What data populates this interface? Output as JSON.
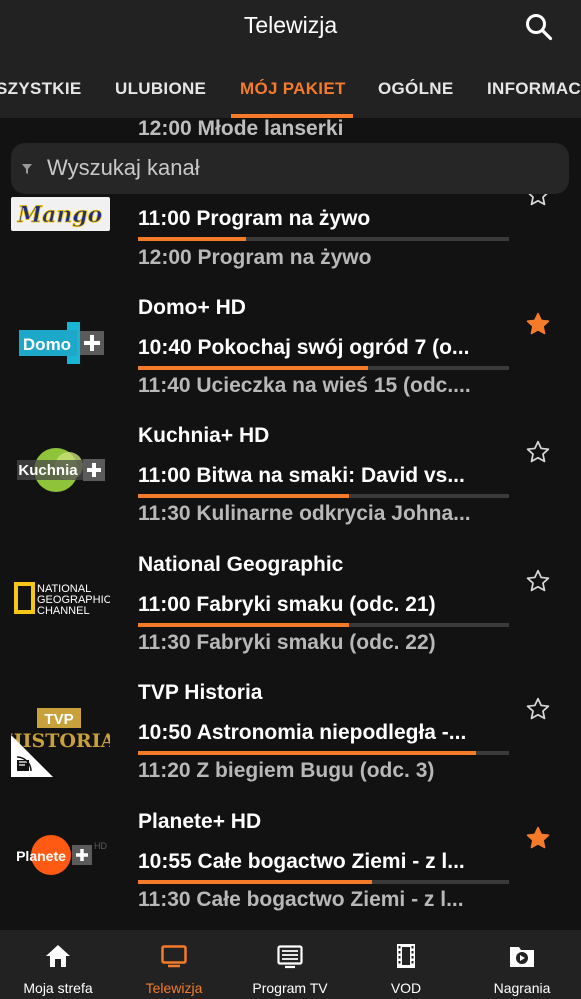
{
  "header": {
    "title": "Telewizja"
  },
  "tabs": [
    {
      "label": "SZYSTKIE",
      "active": false
    },
    {
      "label": "ULUBIONE",
      "active": false
    },
    {
      "label": "MÓJ PAKIET",
      "active": true
    },
    {
      "label": "OGÓLNE",
      "active": false
    },
    {
      "label": "INFORMACJ",
      "active": false
    }
  ],
  "search": {
    "placeholder": "Wyszukaj kanał"
  },
  "partial_row": {
    "next": "12:00 Młode lanserki"
  },
  "channels": [
    {
      "name": "",
      "logo": "Mango",
      "now": "11:00 Program na żywo",
      "progress": 0.29,
      "next": "12:00 Program na żywo",
      "favorite": false
    },
    {
      "name": "Domo+ HD",
      "logo": "Domo+",
      "now": "10:40 Pokochaj swój ogród 7 (o...",
      "progress": 0.62,
      "next": "11:40 Ucieczka na wieś 15 (odc....",
      "favorite": true
    },
    {
      "name": "Kuchnia+ HD",
      "logo": "Kuchnia+",
      "now": "11:00 Bitwa na smaki: David vs...",
      "progress": 0.57,
      "next": "11:30 Kulinarne odkrycia Johna...",
      "favorite": false
    },
    {
      "name": "National Geographic",
      "logo_lines": [
        "NATIONAL",
        "GEOGRAPHIC",
        "CHANNEL"
      ],
      "now": "11:00 Fabryki smaku (odc. 21)",
      "progress": 0.57,
      "next": "11:30 Fabryki smaku (odc. 22)",
      "favorite": false
    },
    {
      "name": "TVP Historia",
      "logo_lines": [
        "TVP",
        "HISTORIA"
      ],
      "now": "10:50 Astronomia niepodległa -...",
      "progress": 0.91,
      "next": "11:20 Z biegiem Bugu (odc. 3)",
      "favorite": false
    },
    {
      "name": "Planete+ HD",
      "logo": "Planete+",
      "logo_suffix": "HD",
      "now": "10:55 Całe bogactwo Ziemi - z l...",
      "progress": 0.63,
      "next": "11:30 Całe bogactwo Ziemi - z l...",
      "favorite": true
    }
  ],
  "bottom_nav": [
    {
      "label": "Moja strefa",
      "icon": "home-icon",
      "active": false
    },
    {
      "label": "Telewizja",
      "icon": "tv-icon",
      "active": true
    },
    {
      "label": "Program TV",
      "icon": "guide-icon",
      "active": false
    },
    {
      "label": "VOD",
      "icon": "film-icon",
      "active": false
    },
    {
      "label": "Nagrania",
      "icon": "recordings-icon",
      "active": false
    }
  ],
  "colors": {
    "accent": "#f57b2b",
    "background": "#121212",
    "bar": "#222222"
  }
}
